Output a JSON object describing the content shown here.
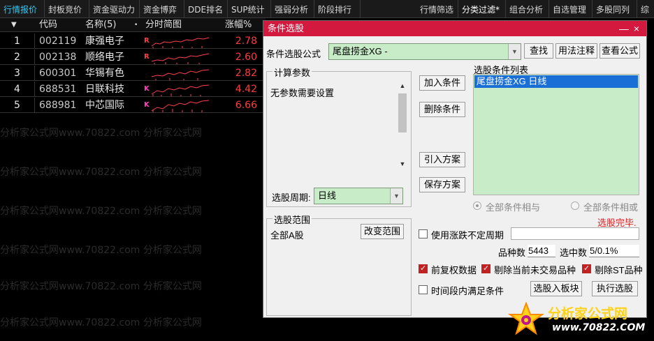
{
  "topbar": {
    "tabs": [
      "行情报价",
      "封板竞价",
      "资金驱动力",
      "资金博弈",
      "DDE排名",
      "SUP统计",
      "强弱分析",
      "阶段排行"
    ],
    "right_tabs": [
      "行情筛选",
      "分类过滤*",
      "组合分析",
      "自选管理",
      "多股同列",
      "综"
    ]
  },
  "table": {
    "headers": {
      "no": "",
      "code": "代码",
      "name": "名称(5)",
      "chart": "分时简图",
      "pct": "涨幅%"
    },
    "rows": [
      {
        "no": "1",
        "code": "002119",
        "name": "康强电子",
        "badge": "R",
        "pct": "2.78"
      },
      {
        "no": "2",
        "code": "002138",
        "name": "顺络电子",
        "badge": "R",
        "pct": "2.60"
      },
      {
        "no": "3",
        "code": "600301",
        "name": "华锡有色",
        "badge": "",
        "pct": "2.82"
      },
      {
        "no": "4",
        "code": "688531",
        "name": "日联科技",
        "badge": "K",
        "pct": "4.42"
      },
      {
        "no": "5",
        "code": "688981",
        "name": "中芯国际",
        "badge": "K",
        "pct": "6.66"
      }
    ]
  },
  "watermark": {
    "text": "分析家公式网www.70822.com",
    "faint_text": "分析家公式网www.70822.com 分析家公式网"
  },
  "dialog": {
    "title": "条件选股",
    "formula_label": "条件选股公式",
    "formula_value": "尾盘捞金XG  -",
    "find_button": "查找",
    "usage_button": "用法注释",
    "view_formula_button": "查看公式",
    "params_group": "计算参数",
    "params_text": "无参数需要设置",
    "period_label": "选股周期:",
    "period_value": "日线",
    "add_condition": "加入条件",
    "delete_condition": "删除条件",
    "import_plan": "引入方案",
    "save_plan": "保存方案",
    "list_title": "选股条件列表",
    "list_items": [
      "尾盘捞金XG  日线"
    ],
    "radio_and": "全部条件相与",
    "radio_or": "全部条件相或",
    "status": "选股完毕.",
    "range_group": "选股范围",
    "range_value": "全部A股",
    "change_range": "改变范围",
    "use_period": "使用涨跌不定周期",
    "count_label": "品种数",
    "count_value": "5443",
    "selected_label": "选中数",
    "selected_value": "5/0.1%",
    "forward_adjust": "前复权数据",
    "remove_no_trade": "剔除当前未交易品种",
    "remove_st": "剔除ST品种",
    "time_range": "时间段内满足条件",
    "to_block": "选股入板块",
    "execute": "执行选股",
    "close_icon": "×",
    "minimize_icon": "—"
  },
  "logo": {
    "text": "分析家公式网",
    "url": "www.70822.COM"
  },
  "colors": {
    "accent_red": "#d4193f",
    "price_up": "#ff3c3c",
    "green_field": "#c8ecc8",
    "highlight": "#38c8f0"
  }
}
